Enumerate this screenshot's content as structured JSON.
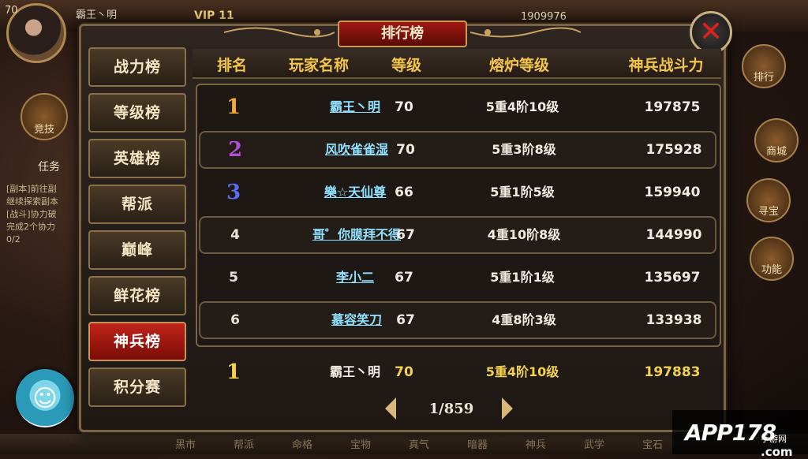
{
  "hud": {
    "level": "70",
    "player_name": "霸王丶明",
    "vip": "VIP 11",
    "gold": "1909976",
    "left_button": "竞技",
    "task_label": "任务",
    "task_lines": [
      "[副本]前往副",
      "继续探索副本",
      "[战斗]协力破",
      "完成2个协力",
      "0/2"
    ],
    "right_buttons": [
      "排行",
      "商城",
      "寻宝",
      "功能"
    ]
  },
  "panel": {
    "title": "排行榜",
    "close_icon": "close-x-icon"
  },
  "sidebar": {
    "tabs": [
      {
        "label": "战力榜",
        "active": false
      },
      {
        "label": "等级榜",
        "active": false
      },
      {
        "label": "英雄榜",
        "active": false
      },
      {
        "label": "帮派",
        "active": false
      },
      {
        "label": "巅峰",
        "active": false
      },
      {
        "label": "鲜花榜",
        "active": false
      },
      {
        "label": "神兵榜",
        "active": true
      },
      {
        "label": "积分赛",
        "active": false
      }
    ]
  },
  "table": {
    "headers": {
      "rank": "排名",
      "name": "玩家名称",
      "level": "等级",
      "furnace": "熔炉等级",
      "power": "神兵战斗力"
    },
    "rows": [
      {
        "rank": "1",
        "name": "霸王丶明",
        "level": "70",
        "furnace": "5重4阶10级",
        "power": "197875"
      },
      {
        "rank": "2",
        "name": "风吹雀雀湿",
        "level": "70",
        "furnace": "5重3阶8级",
        "power": "175928"
      },
      {
        "rank": "3",
        "name": "樂☆天仙尊",
        "level": "66",
        "furnace": "5重1阶5级",
        "power": "159940"
      },
      {
        "rank": "4",
        "name": "哥゜你膜拜不得",
        "level": "67",
        "furnace": "4重10阶8级",
        "power": "144990"
      },
      {
        "rank": "5",
        "name": "李小二",
        "level": "67",
        "furnace": "5重1阶1级",
        "power": "135697"
      },
      {
        "rank": "6",
        "name": "慕容笑刀",
        "level": "67",
        "furnace": "4重8阶3级",
        "power": "133938"
      }
    ],
    "my_row": {
      "rank": "1",
      "name": "霸王丶明",
      "level": "70",
      "furnace": "5重4阶10级",
      "power": "197883"
    }
  },
  "pager": {
    "text": "1/859",
    "prev_icon": "arrow-left-icon",
    "next_icon": "arrow-right-icon"
  },
  "bottom_bar": {
    "items": [
      "黑市",
      "帮派",
      "命格",
      "宝物",
      "真气",
      "暗器",
      "神兵",
      "武学",
      "宝石"
    ]
  },
  "watermark": {
    "brand": "APP178",
    "sub": "手游网",
    "domain": ".com"
  },
  "colors": {
    "header_gold": "#f4c54a",
    "name_link": "#8fe0ff",
    "rank1": "#f3a83a",
    "rank2": "#b04ed8",
    "rank3": "#5a6cf0",
    "active_tab": "#c02418",
    "close_x": "#e0201a"
  }
}
